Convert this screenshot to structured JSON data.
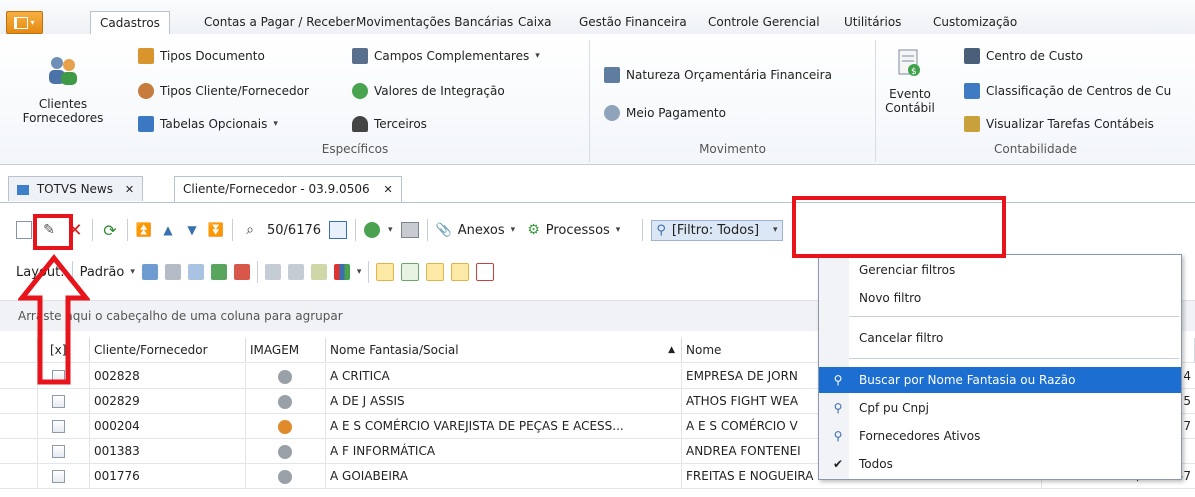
{
  "ribbon_tabs": [
    "Cadastros",
    "Contas a Pagar / Receber",
    "Movimentações Bancárias",
    "Caixa",
    "Gestão Financeira",
    "Controle Gerencial",
    "Utilitários",
    "Customização"
  ],
  "ribbon": {
    "clientes_label_1": "Clientes",
    "clientes_label_2": "Fornecedores",
    "especificos": {
      "items": [
        "Tipos Documento",
        "Tipos Cliente/Fornecedor",
        "Tabelas Opcionais",
        "Campos Complementares",
        "Valores de Integração",
        "Terceiros"
      ],
      "label": "Específicos"
    },
    "movimento": {
      "items": [
        "Natureza Orçamentária Financeira",
        "Meio Pagamento"
      ],
      "label": "Movimento"
    },
    "contabilidade": {
      "evento_1": "Evento",
      "evento_2": "Contábil",
      "items": [
        "Centro de Custo",
        "Classificação de Centros de Cu",
        "Visualizar Tarefas Contábeis"
      ],
      "label": "Contabilidade"
    }
  },
  "doc_tabs": [
    {
      "label": "TOTVS News",
      "close": "✕"
    },
    {
      "label": "Cliente/Fornecedor - 03.9.0506",
      "close": "✕"
    }
  ],
  "toolbar": {
    "record_count": "50/6176",
    "anexos": "Anexos",
    "processos": "Processos",
    "filtro": "[Filtro: Todos]"
  },
  "layout_bar": {
    "layout_label": "Layout:",
    "padrao": "Padrão"
  },
  "group_hint": "Arraste aqui o cabeçalho de uma coluna para agrupar",
  "grid": {
    "columns": [
      "[x]",
      "Cliente/Fornecedor",
      "IMAGEM",
      "Nome Fantasia/Social",
      "Nome"
    ],
    "rows": [
      {
        "code": "002828",
        "fantasia": "A CRITICA",
        "nome": "EMPRESA DE JORN",
        "extra": "4"
      },
      {
        "code": "002829",
        "fantasia": "A DE J ASSIS",
        "nome": "ATHOS FIGHT WEA",
        "extra": "5"
      },
      {
        "code": "000204",
        "fantasia": "A E S COMÉRCIO VAREJISTA DE PEÇAS E ACESS...",
        "nome": "A E S COMÉRCIO V",
        "extra": "7"
      },
      {
        "code": "001383",
        "fantasia": "A F INFORMÁTICA",
        "nome": "ANDREA FONTENEI",
        "extra": ""
      },
      {
        "code": "001776",
        "fantasia": "A GOIABEIRA",
        "nome": "FREITAS E NOGUEIRA LTDA ME",
        "extra": "12.827.633/0001-57"
      }
    ]
  },
  "filter_menu": {
    "items": [
      "Gerenciar filtros",
      "Novo filtro",
      "Cancelar filtro",
      "Buscar por Nome Fantasia ou Razão",
      "Cpf pu Cnpj",
      "Fornecedores Ativos",
      "Todos"
    ],
    "check": "✔"
  },
  "colors": {
    "accent": "#f2a334",
    "highlight": "#1c6fd0",
    "annotation": "#e8141b"
  }
}
